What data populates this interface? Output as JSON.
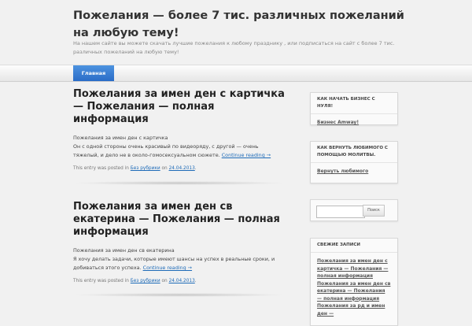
{
  "header": {
    "title": "Пожелания — более 7 тис. различных пожеланий на любую тему!",
    "description": "На нашем сайте вы можете скачать лучшие пожелания к любому празднику , или подписаться на сайт с более 7 тис. различных пожеланий на любую тему!"
  },
  "nav": {
    "home_label": "Главная"
  },
  "posts": [
    {
      "title": "Пожелания за имен ден с картичка — Пожелания — полная информация",
      "line1": "Пожелания за имен ден с картичка",
      "line2": "Он с одной стороны очень красивый по видеоряду, с другой — очень тяжелый, и дело не в около-гомосексуальном сюжете.",
      "continue_label": "Continue reading →",
      "meta_prefix": "This entry was posted in",
      "category": "Без рубрики",
      "meta_on": "on",
      "date": "24.04.2013",
      "meta_end": "."
    },
    {
      "title": "Пожелания за имен ден св екатерина — Пожелания — полная информация",
      "line1": "Пожелания за имен ден св екатерина",
      "line2": "Я хочу делать задачи, которые имеют шансы на успех в реальные сроки, и добиваться этого успеха.",
      "continue_label": "Continue reading →",
      "meta_prefix": "This entry was posted in",
      "category": "Без рубрики",
      "meta_on": "on",
      "date": "24.04.2013",
      "meta_end": "."
    }
  ],
  "sidebar": {
    "widget1": {
      "title": "КАК НАЧАТЬ БИЗНЕС С НУЛЯ!",
      "link": "Бизнес Amway!"
    },
    "widget2": {
      "title": "КАК ВЕРНУТЬ ЛЮБИМОГО С ПОМОЩЬЮ МОЛИТВЫ.",
      "link": "Вернуть любимого"
    },
    "search": {
      "button_label": "Поиск",
      "placeholder": ""
    },
    "recent": {
      "title": "СВЕЖИЕ ЗАПИСИ",
      "items": [
        "Пожелания за имен ден с картичка — Пожелания — полная информация",
        "Пожелания за имен ден св екатерина — Пожелания — полная информация",
        "Пожелания за рд и имен ден —"
      ]
    }
  },
  "colors": {
    "accent": "#2a6cc7",
    "link": "#1e6bb8",
    "background": "#f1f1f1"
  }
}
